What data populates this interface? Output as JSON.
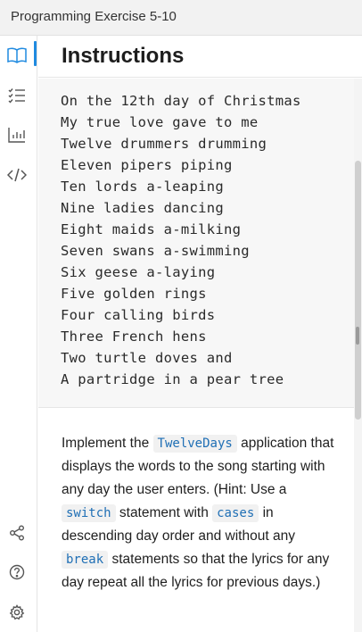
{
  "window": {
    "title": "Programming Exercise 5-10"
  },
  "sidebar": {
    "items": [
      {
        "icon": "book-icon",
        "active": true
      },
      {
        "icon": "checklist-icon",
        "active": false
      },
      {
        "icon": "bar-chart-icon",
        "active": false
      },
      {
        "icon": "code-icon",
        "active": false
      }
    ],
    "bottom_items": [
      {
        "icon": "share-icon"
      },
      {
        "icon": "help-icon"
      },
      {
        "icon": "settings-icon"
      }
    ],
    "accent_color": "#1f8ae0"
  },
  "main": {
    "heading": "Instructions",
    "poem_lines": [
      "On the 12th day of Christmas",
      "My true love gave to me",
      "Twelve drummers drumming",
      "Eleven pipers piping",
      "Ten lords a-leaping",
      "Nine ladies dancing",
      "Eight maids a-milking",
      "Seven swans a-swimming",
      "Six geese a-laying",
      "Five golden rings",
      "Four calling birds",
      "Three French hens",
      "Two turtle doves and",
      "A partridge in a pear tree"
    ],
    "paragraph": {
      "t1": "Implement the ",
      "code1": "TwelveDays",
      "t2": " application that displays the words to the song starting with any day the user enters. (Hint: Use a ",
      "code2": "switch",
      "t3": " statement with ",
      "code3": "cases",
      "t4": " in descending day order and without any ",
      "code4": "break",
      "t5": " statements so that the lyrics for any day repeat all the lyrics for previous days.)"
    }
  }
}
